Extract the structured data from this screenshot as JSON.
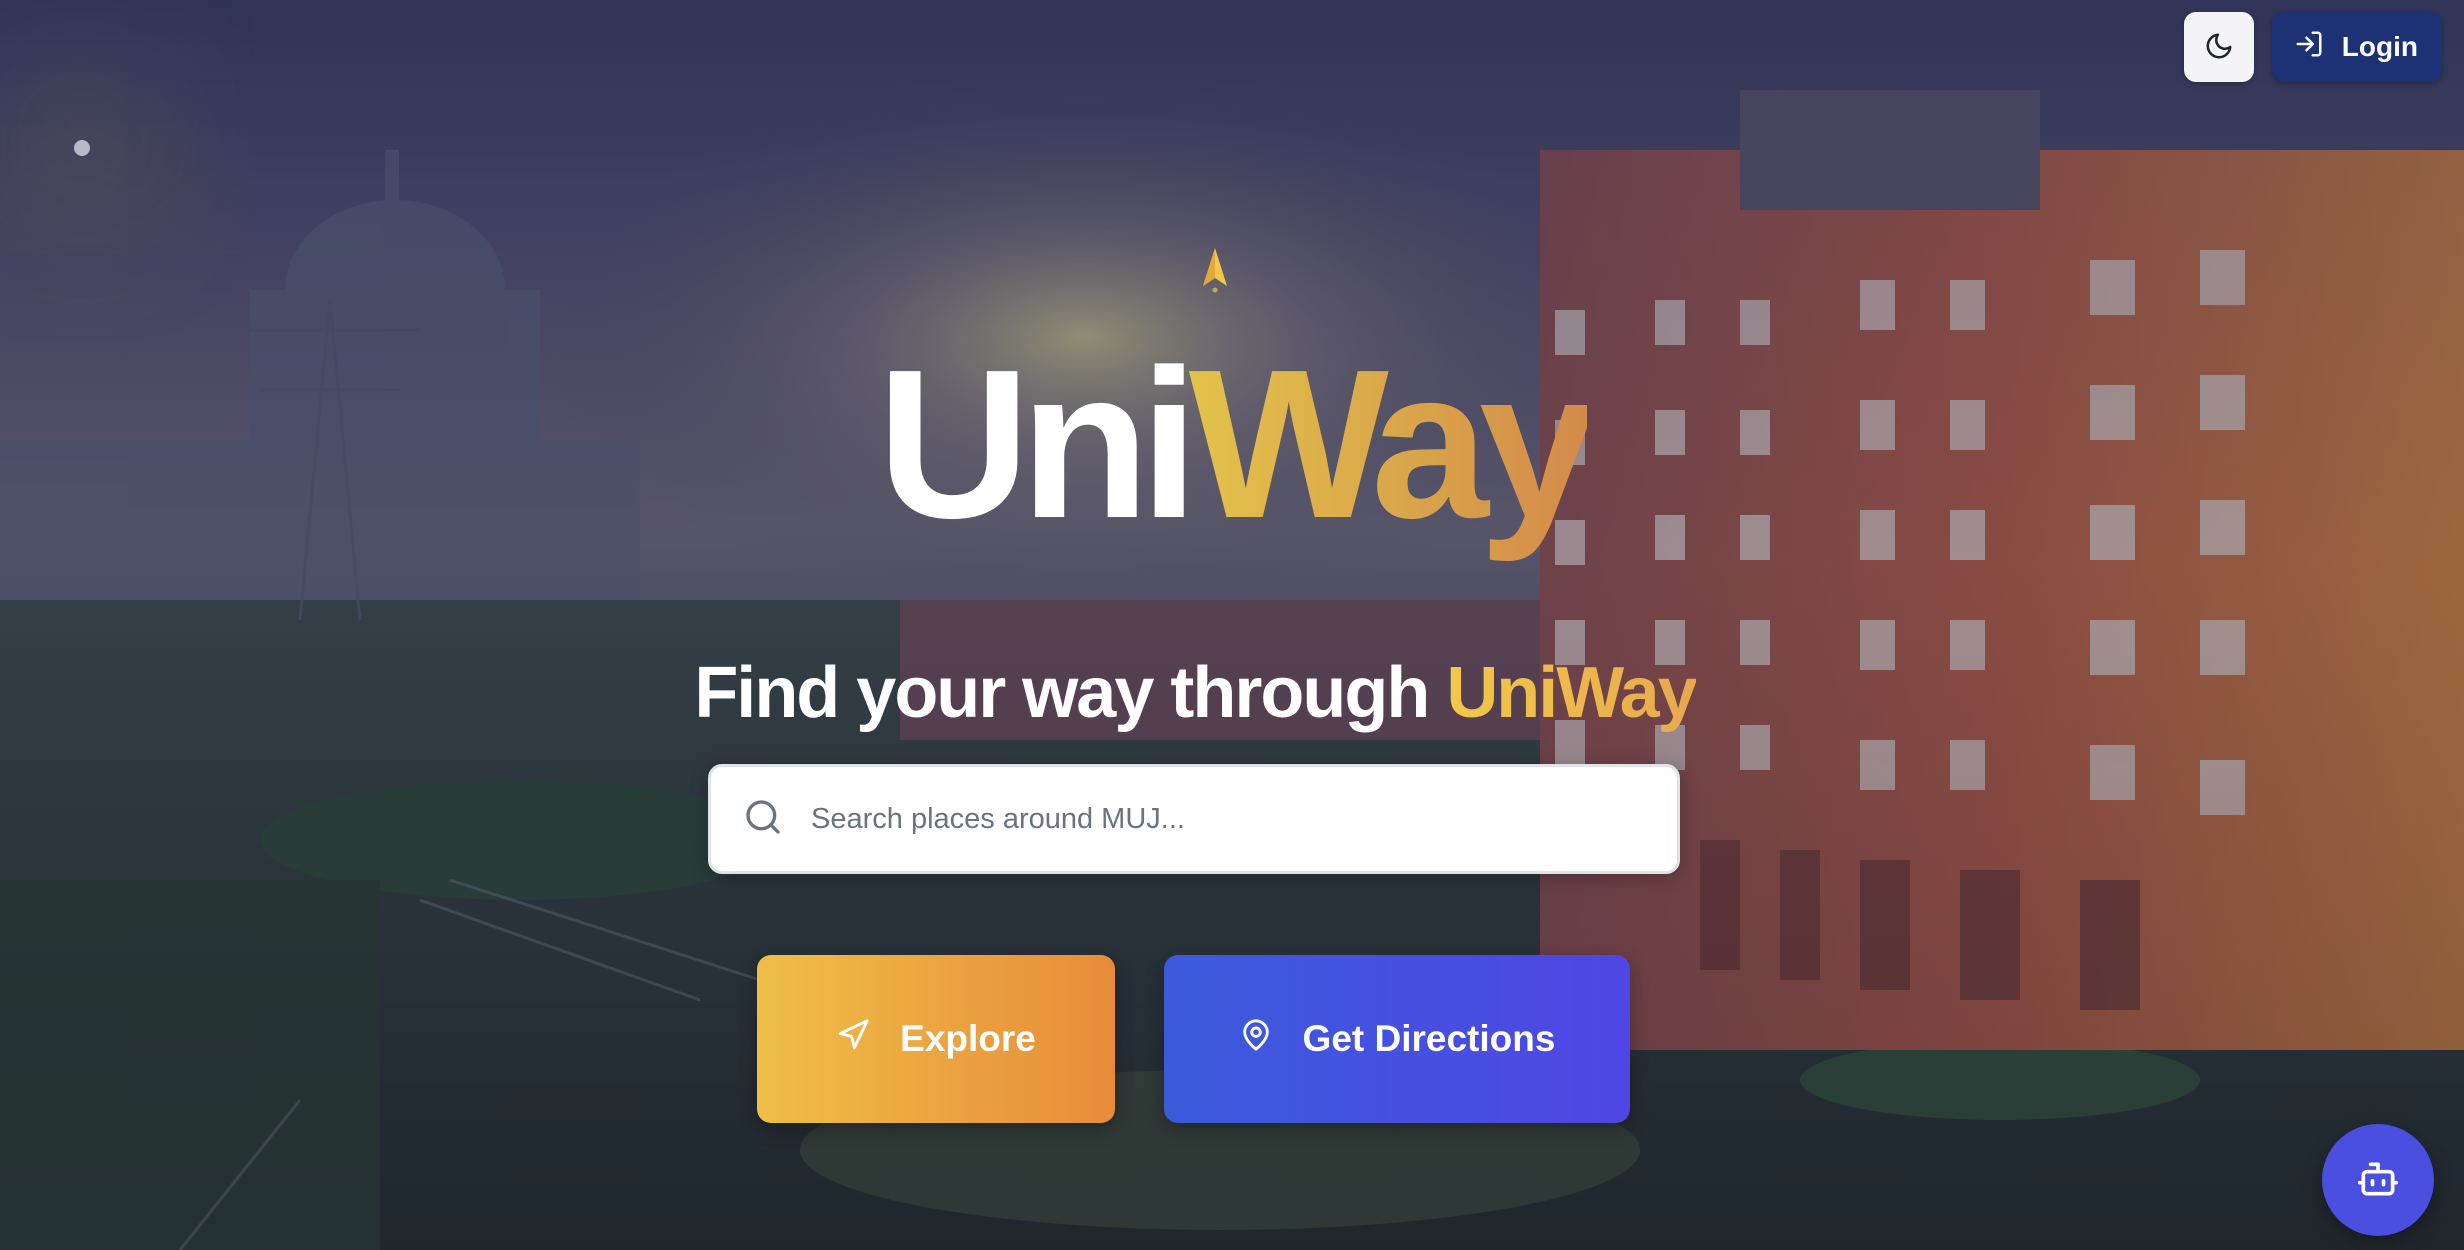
{
  "header": {
    "theme_toggle_icon": "moon-icon",
    "login_label": "Login",
    "login_icon": "login-arrow-icon"
  },
  "hero": {
    "logo_part1": "Uni",
    "logo_part2": "Way",
    "tagline_prefix": "Find your way through ",
    "tagline_brand": "UniWay",
    "spark_icon": "compass-needle-icon"
  },
  "search": {
    "placeholder": "Search places around MUJ...",
    "value": "",
    "icon": "search-icon"
  },
  "actions": {
    "explore_label": "Explore",
    "explore_icon": "navigation-arrow-icon",
    "directions_label": "Get Directions",
    "directions_icon": "map-pin-icon"
  },
  "assistant": {
    "icon": "robot-icon"
  },
  "colors": {
    "accent_gold": "#e3c24a",
    "accent_orange": "#e88c3a",
    "primary_blue": "#4f46e5",
    "login_bg": "#1d3275"
  }
}
